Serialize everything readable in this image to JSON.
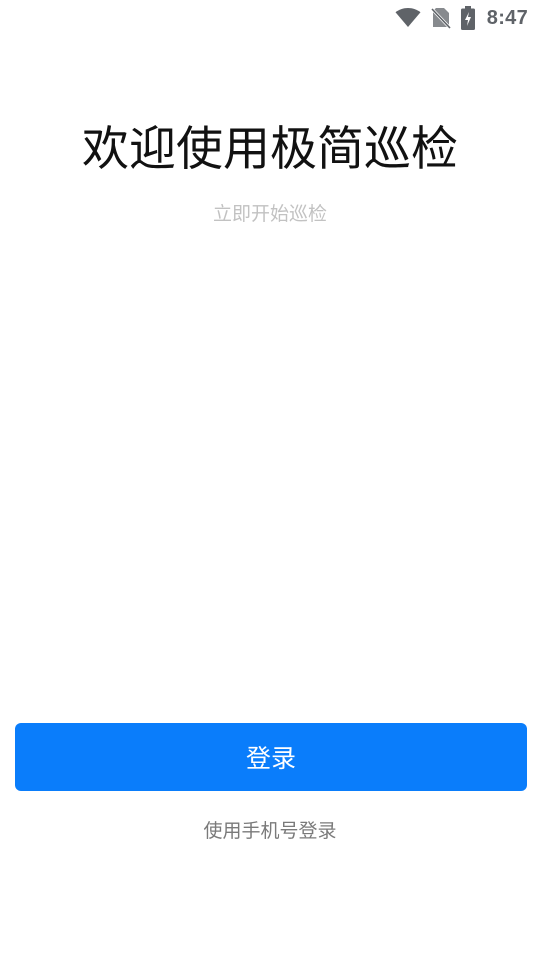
{
  "status_bar": {
    "time": "8:47",
    "icons": [
      "wifi-icon",
      "no-sim-icon",
      "battery-charging-icon"
    ]
  },
  "welcome": {
    "title": "欢迎使用极简巡检",
    "subtitle": "立即开始巡检"
  },
  "actions": {
    "login_label": "登录",
    "phone_login_label": "使用手机号登录"
  },
  "colors": {
    "accent": "#0a7dfb",
    "title_text": "#111111",
    "subtitle_text": "#c2c2c2",
    "link_text": "#7a7a7a",
    "status_icon": "#5f6368",
    "background": "#ffffff"
  }
}
